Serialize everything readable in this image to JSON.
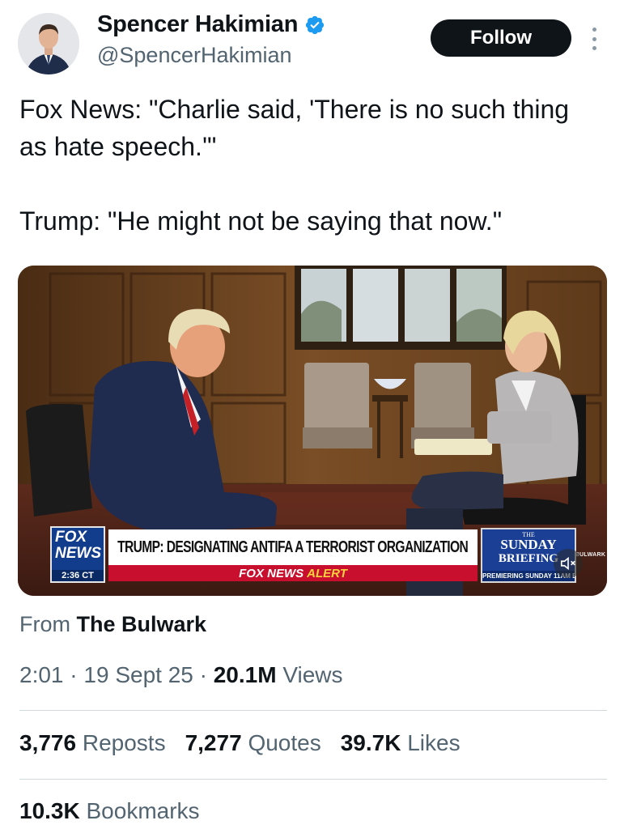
{
  "author": {
    "display_name": "Spencer Hakimian",
    "handle": "@SpencerHakimian",
    "verified_color": "#1d9bf0"
  },
  "follow_label": "Follow",
  "tweet": {
    "text": "Fox News: \"Charlie said, 'There is no such thing as hate speech.'\"\n\nTrump: \"He might not be saying that now.\""
  },
  "media": {
    "watermark": "THEBULWARK",
    "chyron": {
      "network_line1": "FOX",
      "network_line2": "NEWS",
      "time": "2:36 CT",
      "headline": "TRUMP: DESIGNATING ANTIFA A TERRORIST ORGANIZATION",
      "alert_prefix": "FOX NEWS",
      "alert_word": "ALERT",
      "promo_the": "THE",
      "promo_line1": "SUNDAY",
      "promo_line2": "BRIEFING",
      "promo_sub": "PREMIERING SUNDAY 11AM ET"
    },
    "mute_icon": "speaker-muted-icon"
  },
  "source": {
    "prefix": "From",
    "name": "The Bulwark"
  },
  "meta": {
    "time": "2:01",
    "date": "19 Sept 25",
    "views_count": "20.1M",
    "views_label": "Views"
  },
  "stats": {
    "reposts_count": "3,776",
    "reposts_label": "Reposts",
    "quotes_count": "7,277",
    "quotes_label": "Quotes",
    "likes_count": "39.7K",
    "likes_label": "Likes",
    "bookmarks_count": "10.3K",
    "bookmarks_label": "Bookmarks"
  },
  "colors": {
    "text_primary": "#0f1419",
    "text_secondary": "#536471",
    "follow_bg": "#0f1419",
    "fox_blue": "#123c8c",
    "alert_red": "#c8102e"
  }
}
